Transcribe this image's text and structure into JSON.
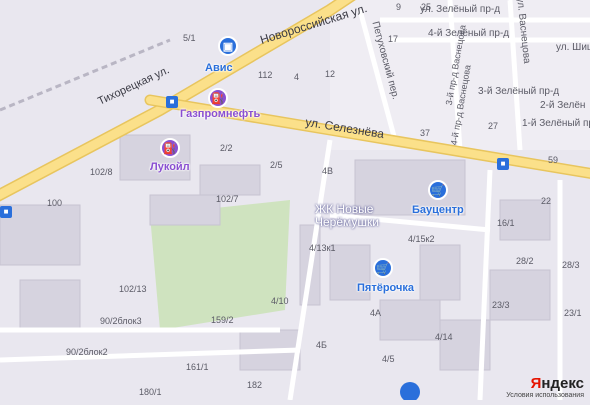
{
  "map": {
    "streets": {
      "novorossiyskaya": "Новороссийская ул.",
      "tikhoretskaya": "Тихорецкая ул.",
      "seleznyova": "ул. Селезнёва",
      "petukhovsky": "Петуховский пер.",
      "vasnetsova": "ул. Васнецова",
      "shish": "ул. Шиш",
      "zeleny4": "4-й Зелёный пр-д",
      "zeleny3": "3-й Зелёный пр-д",
      "zeleny2": "2-й Зелён",
      "zeleny1": "1-й Зелёный пр",
      "zeleny_top": "ул. Зелёный пр-д",
      "vasnetsova_pr4": "4-й пр-д Васнецова",
      "vasnetsova_pr3": "3-й пр-д Васнецова"
    },
    "pois": {
      "avis": "Авис",
      "gazpromneft": "Газпромнефть",
      "lukoil": "Лукойл",
      "bauzentr": "Бауцентр",
      "pyaterochka": "Пятёрочка"
    },
    "district": "ЖК Новые Черёмушки",
    "house_numbers": [
      "5/1",
      "112",
      "4",
      "12",
      "17",
      "9",
      "25",
      "2/2",
      "2/5",
      "4В",
      "37",
      "27",
      "59",
      "102/8",
      "100",
      "102/7",
      "22",
      "16/1",
      "4/13к1",
      "4/15к2",
      "28/2",
      "28/3",
      "102/13",
      "4/10",
      "23/3",
      "90/2блок3",
      "159/2",
      "4А",
      "23/1",
      "90/2блок2",
      "4/14",
      "4Б",
      "4/5",
      "161/1",
      "182",
      "180/1"
    ],
    "attribution": {
      "brand_part1": "Я",
      "brand_part2": "ндекс",
      "terms": "Условия использования"
    },
    "colors": {
      "background": "#e9e7ef",
      "main_road": "#fbe08a",
      "park": "#cfe3bf",
      "poi_orange": "#e8862d",
      "poi_purple": "#8a4fd1",
      "poi_blue": "#2a6fdb"
    }
  }
}
